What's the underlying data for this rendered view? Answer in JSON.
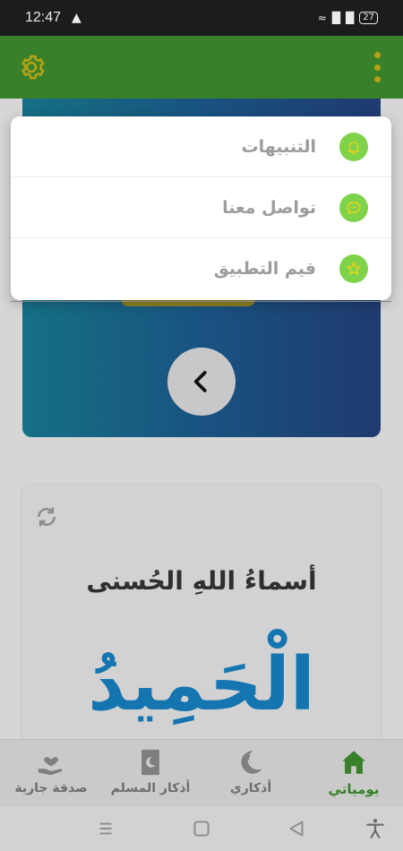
{
  "status_bar": {
    "time": "12:47",
    "battery": "27"
  },
  "app_bar": {
    "settings_icon": "gear-icon",
    "more_icon": "more-vertical-icon"
  },
  "popup_menu": {
    "items": [
      {
        "label": "التنبيهات",
        "icon": "bell-icon"
      },
      {
        "label": "تواصل معنا",
        "icon": "chat-icon"
      },
      {
        "label": "قيم التطبيق",
        "icon": "star-icon"
      }
    ]
  },
  "names_card": {
    "title": "أسماءُ اللهِ الحُسنى",
    "name": "الْحَمِيدُ"
  },
  "bottom_nav": {
    "items": [
      {
        "label": "يومياتي",
        "icon": "home-icon",
        "active": true
      },
      {
        "label": "أذكاري",
        "icon": "crescent-star-icon",
        "active": false
      },
      {
        "label": "أذكار المسلم",
        "icon": "book-crescent-icon",
        "active": false
      },
      {
        "label": "صدقة جارية",
        "icon": "hand-heart-icon",
        "active": false
      }
    ]
  },
  "colors": {
    "primary_green": "#3d8b2e",
    "accent_gold": "#c3b01a",
    "menu_icon_green": "#7fd34a",
    "name_blue": "#177fbf"
  }
}
